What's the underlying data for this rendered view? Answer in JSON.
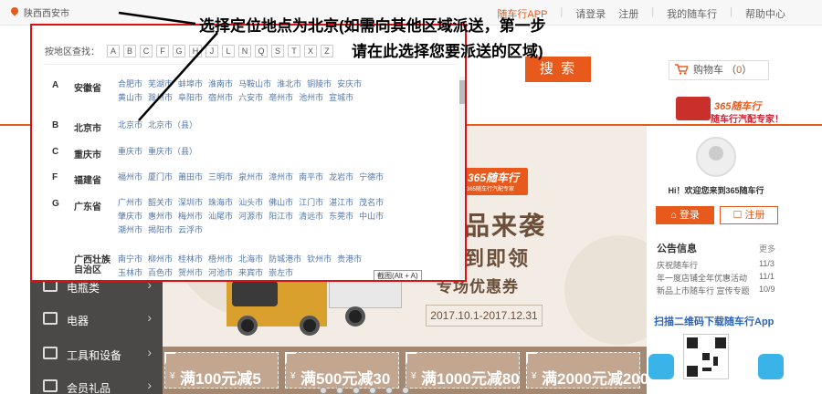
{
  "topbar": {
    "location_label": "陕西省(西安市",
    "links": [
      "随车行APP",
      "请登录",
      "注册",
      "我的随车行",
      "帮助中心"
    ]
  },
  "search": {
    "button_label": "搜 索"
  },
  "cart": {
    "label": "购物车",
    "count": "0"
  },
  "promo": {
    "line1": "365随车行",
    "line2": "随车行汽配专家！"
  },
  "dropdown": {
    "top_location": "陕西西安市",
    "letters_label": "按地区查找：",
    "letters": [
      "A",
      "B",
      "C",
      "F",
      "G",
      "H",
      "J",
      "L",
      "N",
      "Q",
      "S",
      "T",
      "X",
      "Z"
    ],
    "provinces": [
      {
        "letter": "A",
        "name": "安徽省",
        "cities": [
          "合肥市",
          "芜湖市",
          "蚌埠市",
          "淮南市",
          "马鞍山市",
          "淮北市",
          "铜陵市",
          "安庆市",
          "黄山市",
          "滁州市",
          "阜阳市",
          "宿州市",
          "六安市",
          "亳州市",
          "池州市",
          "宣城市"
        ]
      },
      {
        "letter": "B",
        "name": "北京市",
        "cities": [
          "北京市",
          "北京市（县）"
        ]
      },
      {
        "letter": "C",
        "name": "重庆市",
        "cities": [
          "重庆市",
          "重庆市（县）"
        ]
      },
      {
        "letter": "F",
        "name": "福建省",
        "cities": [
          "福州市",
          "厦门市",
          "莆田市",
          "三明市",
          "泉州市",
          "漳州市",
          "南平市",
          "龙岩市",
          "宁德市"
        ]
      },
      {
        "letter": "G",
        "name": "广东省",
        "cities": [
          "广州市",
          "韶关市",
          "深圳市",
          "珠海市",
          "汕头市",
          "佛山市",
          "江门市",
          "湛江市",
          "茂名市",
          "肇庆市",
          "惠州市",
          "梅州市",
          "汕尾市",
          "河源市",
          "阳江市",
          "清远市",
          "东莞市",
          "中山市",
          "潮州市",
          "揭阳市",
          "云浮市"
        ]
      },
      {
        "letter": "",
        "name": "广西壮族自治区",
        "cities": [
          "南宁市",
          "柳州市",
          "桂林市",
          "梧州市",
          "北海市",
          "防城港市",
          "钦州市",
          "贵港市",
          "玉林市",
          "百色市",
          "贺州市",
          "河池市",
          "来宾市",
          "崇左市"
        ]
      }
    ],
    "shortcut": "截图(Alt + A)"
  },
  "annotation": {
    "line1": "选择定位地点为北京(如需向其他区域派送，第一步",
    "line2": "请在此选择您要派送的区域)"
  },
  "catnav": [
    {
      "label": "电瓶类",
      "icon": "battery-icon"
    },
    {
      "label": "电器",
      "icon": "plug-icon"
    },
    {
      "label": "工具和设备",
      "icon": "toolbox-icon"
    },
    {
      "label": "会员礼品",
      "icon": "gift-icon"
    }
  ],
  "banner": {
    "logo_line1": "365随车行",
    "logo_line2": "365随车行汽配专家",
    "headline1": "品来袭",
    "headline2": "到即领",
    "headline3": "专场优惠券",
    "date_range": "2017.10.1-2017.12.31"
  },
  "coupons": [
    {
      "yen": "¥",
      "text": "满100元减5"
    },
    {
      "yen": "¥",
      "text": "满500元减30"
    },
    {
      "yen": "¥",
      "text": "满1000元减80"
    },
    {
      "yen": "¥",
      "text": "满2000元减200"
    }
  ],
  "user_panel": {
    "welcome": "Hi！欢迎您来到365随车行",
    "login": "登录",
    "register": "注册"
  },
  "notice": {
    "title": "公告信息",
    "more": "更多",
    "rows": [
      {
        "text": "庆祝随车行",
        "date": "11/3"
      },
      {
        "text": "年一度店铺全年优惠活动",
        "date": "11/1"
      },
      {
        "text": "新品上市随车行 宣传专题",
        "date": "10/9"
      }
    ]
  },
  "qr": {
    "title": "扫描二维码下载随车行App"
  },
  "colors": {
    "accent": "#e85a1b",
    "highlight_border": "#e01010",
    "banner_bg": "#f3ece4",
    "coupon_bar": "#a58872",
    "nav_bg": "#4b4948"
  }
}
